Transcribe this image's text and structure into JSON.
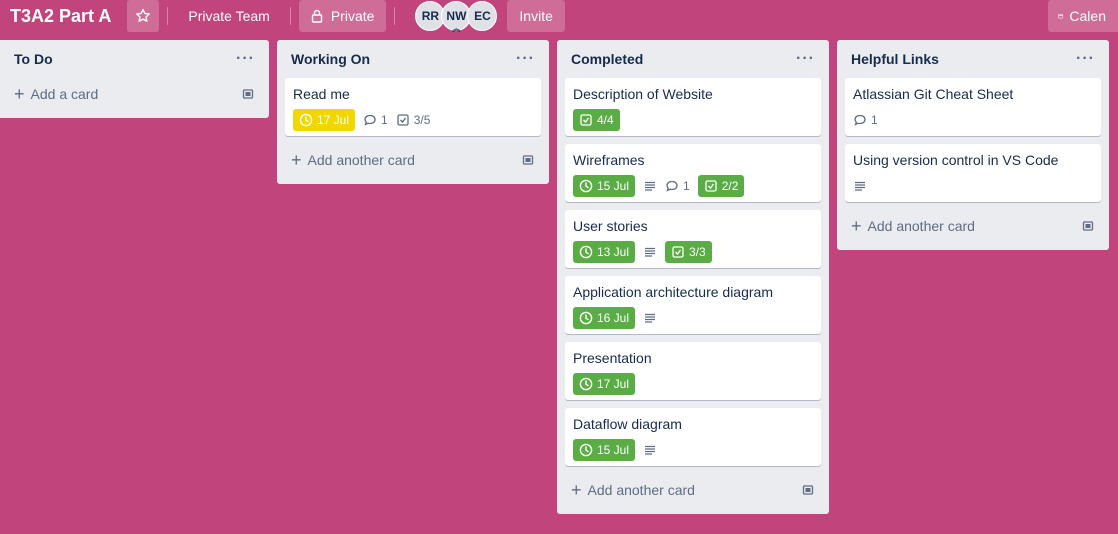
{
  "header": {
    "title": "T3A2 Part A",
    "team": "Private Team",
    "visibility": "Private",
    "members": [
      {
        "initials": "RR"
      },
      {
        "initials": "NW"
      },
      {
        "initials": "EC"
      }
    ],
    "invite": "Invite",
    "calendar": "Calen"
  },
  "lists": [
    {
      "title": "To Do",
      "cards": [],
      "add_label": "Add a card"
    },
    {
      "title": "Working On",
      "cards": [
        {
          "title": "Read me",
          "due": "17 Jul",
          "comments": "1",
          "checklist": "3/5"
        }
      ],
      "add_label": "Add another card"
    },
    {
      "title": "Completed",
      "cards": [
        {
          "title": "Description of Website",
          "checklist": "4/4"
        },
        {
          "title": "Wireframes",
          "due": "15 Jul",
          "comments": "1",
          "checklist": "2/2"
        },
        {
          "title": "User stories",
          "due": "13 Jul",
          "checklist": "3/3"
        },
        {
          "title": "Application architecture diagram",
          "due": "16 Jul"
        },
        {
          "title": "Presentation",
          "due": "17 Jul"
        },
        {
          "title": "Dataflow diagram",
          "due": "15 Jul"
        }
      ],
      "add_label": "Add another card"
    },
    {
      "title": "Helpful Links",
      "cards": [
        {
          "title": "Atlassian Git Cheat Sheet",
          "comments": "1"
        },
        {
          "title": "Using version control in VS Code"
        }
      ],
      "add_label": "Add another card"
    }
  ],
  "colors": {
    "board_bg": "#c2447c",
    "due_done": "#5aac44",
    "due_soon": "#f2d600"
  }
}
